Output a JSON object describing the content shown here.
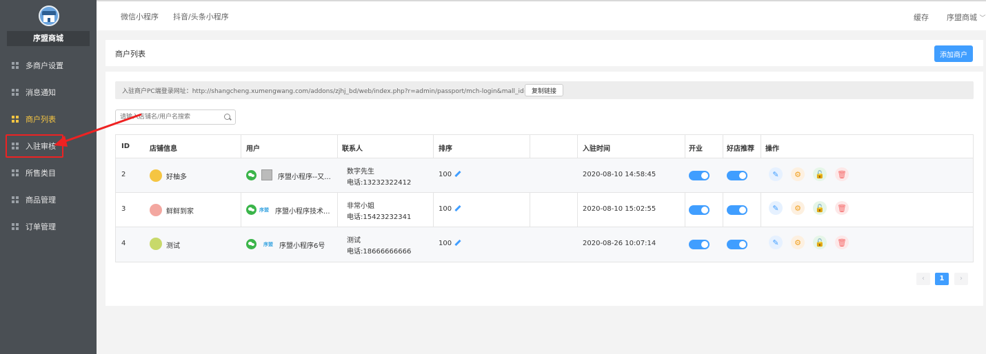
{
  "sidebar": {
    "shop_name": "序盟商城",
    "items": [
      {
        "label": "多商户设置"
      },
      {
        "label": "消息通知"
      },
      {
        "label": "商户列表"
      },
      {
        "label": "入驻审核"
      },
      {
        "label": "所售类目"
      },
      {
        "label": "商品管理"
      },
      {
        "label": "订单管理"
      }
    ],
    "active_index": 2,
    "highlighted_index": 3
  },
  "topbar": {
    "tabs": [
      "微信小程序",
      "抖音/头条小程序"
    ],
    "cache_label": "缓存",
    "account_label": "序盟商城",
    "chevron": "﹀"
  },
  "header": {
    "title": "商户列表",
    "add_button": "添加商户"
  },
  "main": {
    "url_text": "入驻商户PC端登录网址：http://shangcheng.xumengwang.com/addons/zjhj_bd/web/index.php?r=admin/passport/mch-login&mall_id=NTA=",
    "copy_button": "复制链接",
    "search_placeholder": "请输入店铺名/用户名搜索"
  },
  "table": {
    "columns": [
      "ID",
      "店铺信息",
      "用户",
      "联系人",
      "排序",
      "入驻时间",
      "开业",
      "好店推荐",
      "操作"
    ],
    "rows": [
      {
        "id": "2",
        "store": "好柚多",
        "user_logo": "",
        "user": "序盟小程序--又...",
        "contact_name": "数字先生",
        "contact_phone": "电话:13232322412",
        "sort": "100",
        "time": "2020-08-10 14:58:45",
        "open": true,
        "recommend": true
      },
      {
        "id": "3",
        "store": "鲜鲜到家",
        "user_logo": "序盟",
        "user": "序盟小程序技术...",
        "contact_name": "非常小姐",
        "contact_phone": "电话:15423232341",
        "sort": "100",
        "time": "2020-08-10 15:02:55",
        "open": true,
        "recommend": true
      },
      {
        "id": "4",
        "store": "测试",
        "user_logo": "序盟",
        "user": "序盟小程序6号",
        "contact_name": "测试",
        "contact_phone": "电话:18666666666",
        "sort": "100",
        "time": "2020-08-26 10:07:14",
        "open": true,
        "recommend": true
      }
    ]
  },
  "pagination": {
    "current": "1",
    "prev": "‹",
    "next": "›"
  },
  "colors": {
    "sidebar_bg": "#4a4f54",
    "accent": "#409eff",
    "active_menu": "#f5c542",
    "highlight_box": "#e22222"
  },
  "icons": {
    "edit": "✎",
    "gear": "⚙",
    "lock": "🔓",
    "delete": "🗑",
    "sort_edit": "✎"
  }
}
